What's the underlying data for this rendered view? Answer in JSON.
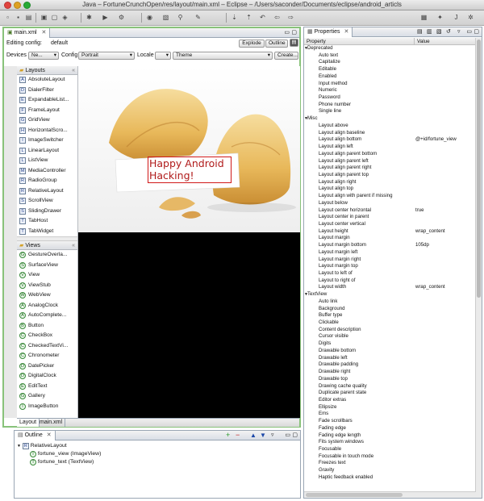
{
  "window": {
    "title": "Java – FortuneCrunchOpen/res/layout/main.xml – Eclipse – /Users/saconder/Documents/eclipse/android_articls"
  },
  "editor": {
    "tab_label": "main.xml",
    "editing_config_label": "Editing config:",
    "editing_config_value": "default",
    "explode_label": "Explode",
    "outline_label": "Outline",
    "devices_label": "Devices",
    "devices_value": "Ne...",
    "config_label": "Config",
    "config_value": "Portrait",
    "locale_label": "Locale",
    "theme_value": "Theme",
    "create_label": "Create...",
    "canvas_text": "Happy Android Hacking!",
    "bottom_tabs": [
      "Layout",
      "main.xml"
    ]
  },
  "palette": {
    "layouts_header": "Layouts",
    "layouts": [
      "AbsoluteLayout",
      "DialerFilter",
      "ExpandableList...",
      "FrameLayout",
      "GridView",
      "HorizontalScro...",
      "ImageSwitcher",
      "LinearLayout",
      "ListView",
      "MediaController",
      "RadioGroup",
      "RelativeLayout",
      "ScrollView",
      "SlidingDrawer",
      "TabHost",
      "TabWidget"
    ],
    "layout_letters": [
      "A",
      "D",
      "E",
      "F",
      "G",
      "H",
      "I",
      "L",
      "L",
      "M",
      "R",
      "R",
      "S",
      "S",
      "T",
      "T"
    ],
    "views_header": "Views",
    "views": [
      "GestureOverla...",
      "SurfaceView",
      "View",
      "ViewStub",
      "WebView",
      "AnalogClock",
      "AutoComplete...",
      "Button",
      "CheckBox",
      "CheckedTextVi...",
      "Chronometer",
      "DatePicker",
      "DigitalClock",
      "EditText",
      "Gallery",
      "ImageButton"
    ],
    "view_letters": [
      "G",
      "S",
      "V",
      "V",
      "W",
      "A",
      "A",
      "B",
      "C",
      "C",
      "C",
      "D",
      "D",
      "E",
      "G",
      "I"
    ]
  },
  "outline": {
    "tab_label": "Outline",
    "root": "RelativeLayout",
    "children": [
      "fortune_view (ImageView)",
      "fortune_text (TextView)"
    ]
  },
  "properties": {
    "tab_label": "Properties",
    "col_property": "Property",
    "col_value": "Value",
    "rows": [
      {
        "k": "Deprecated",
        "v": "",
        "cat": true
      },
      {
        "k": "Auto text",
        "v": ""
      },
      {
        "k": "Capitalize",
        "v": ""
      },
      {
        "k": "Editable",
        "v": ""
      },
      {
        "k": "Enabled",
        "v": ""
      },
      {
        "k": "Input method",
        "v": ""
      },
      {
        "k": "Numeric",
        "v": ""
      },
      {
        "k": "Password",
        "v": ""
      },
      {
        "k": "Phone number",
        "v": ""
      },
      {
        "k": "Single line",
        "v": ""
      },
      {
        "k": "Misc",
        "v": "",
        "cat": true
      },
      {
        "k": "Layout above",
        "v": ""
      },
      {
        "k": "Layout align baseline",
        "v": ""
      },
      {
        "k": "Layout align bottom",
        "v": "@+id/fortune_view"
      },
      {
        "k": "Layout align left",
        "v": ""
      },
      {
        "k": "Layout align parent bottom",
        "v": ""
      },
      {
        "k": "Layout align parent left",
        "v": ""
      },
      {
        "k": "Layout align parent right",
        "v": ""
      },
      {
        "k": "Layout align parent top",
        "v": ""
      },
      {
        "k": "Layout align right",
        "v": ""
      },
      {
        "k": "Layout align top",
        "v": ""
      },
      {
        "k": "Layout align with parent if missing",
        "v": ""
      },
      {
        "k": "Layout below",
        "v": ""
      },
      {
        "k": "Layout center horizontal",
        "v": "true"
      },
      {
        "k": "Layout center in parent",
        "v": ""
      },
      {
        "k": "Layout center vertical",
        "v": ""
      },
      {
        "k": "Layout height",
        "v": "wrap_content"
      },
      {
        "k": "Layout margin",
        "v": ""
      },
      {
        "k": "Layout margin bottom",
        "v": "105dp"
      },
      {
        "k": "Layout margin left",
        "v": ""
      },
      {
        "k": "Layout margin right",
        "v": ""
      },
      {
        "k": "Layout margin top",
        "v": ""
      },
      {
        "k": "Layout to left of",
        "v": ""
      },
      {
        "k": "Layout to right of",
        "v": ""
      },
      {
        "k": "Layout width",
        "v": "wrap_content"
      },
      {
        "k": "TextView",
        "v": "",
        "cat": true
      },
      {
        "k": "Auto link",
        "v": ""
      },
      {
        "k": "Background",
        "v": ""
      },
      {
        "k": "Buffer type",
        "v": ""
      },
      {
        "k": "Clickable",
        "v": ""
      },
      {
        "k": "Content description",
        "v": ""
      },
      {
        "k": "Cursor visible",
        "v": ""
      },
      {
        "k": "Digits",
        "v": ""
      },
      {
        "k": "Drawable bottom",
        "v": ""
      },
      {
        "k": "Drawable left",
        "v": ""
      },
      {
        "k": "Drawable padding",
        "v": ""
      },
      {
        "k": "Drawable right",
        "v": ""
      },
      {
        "k": "Drawable top",
        "v": ""
      },
      {
        "k": "Drawing cache quality",
        "v": ""
      },
      {
        "k": "Duplicate parent state",
        "v": ""
      },
      {
        "k": "Editor extras",
        "v": ""
      },
      {
        "k": "Ellipsize",
        "v": ""
      },
      {
        "k": "Ems",
        "v": ""
      },
      {
        "k": "Fade scrollbars",
        "v": ""
      },
      {
        "k": "Fading edge",
        "v": ""
      },
      {
        "k": "Fading edge length",
        "v": ""
      },
      {
        "k": "Fits system windows",
        "v": ""
      },
      {
        "k": "Focusable",
        "v": ""
      },
      {
        "k": "Focusable in touch mode",
        "v": ""
      },
      {
        "k": "Freezes text",
        "v": ""
      },
      {
        "k": "Gravity",
        "v": ""
      },
      {
        "k": "Haptic feedback enabled",
        "v": ""
      }
    ]
  },
  "colors": {
    "canvas_text": "#b01a1a",
    "selection_box": "#d01818",
    "panel_border": "#9aa6b4",
    "active_border": "#88c27a"
  }
}
